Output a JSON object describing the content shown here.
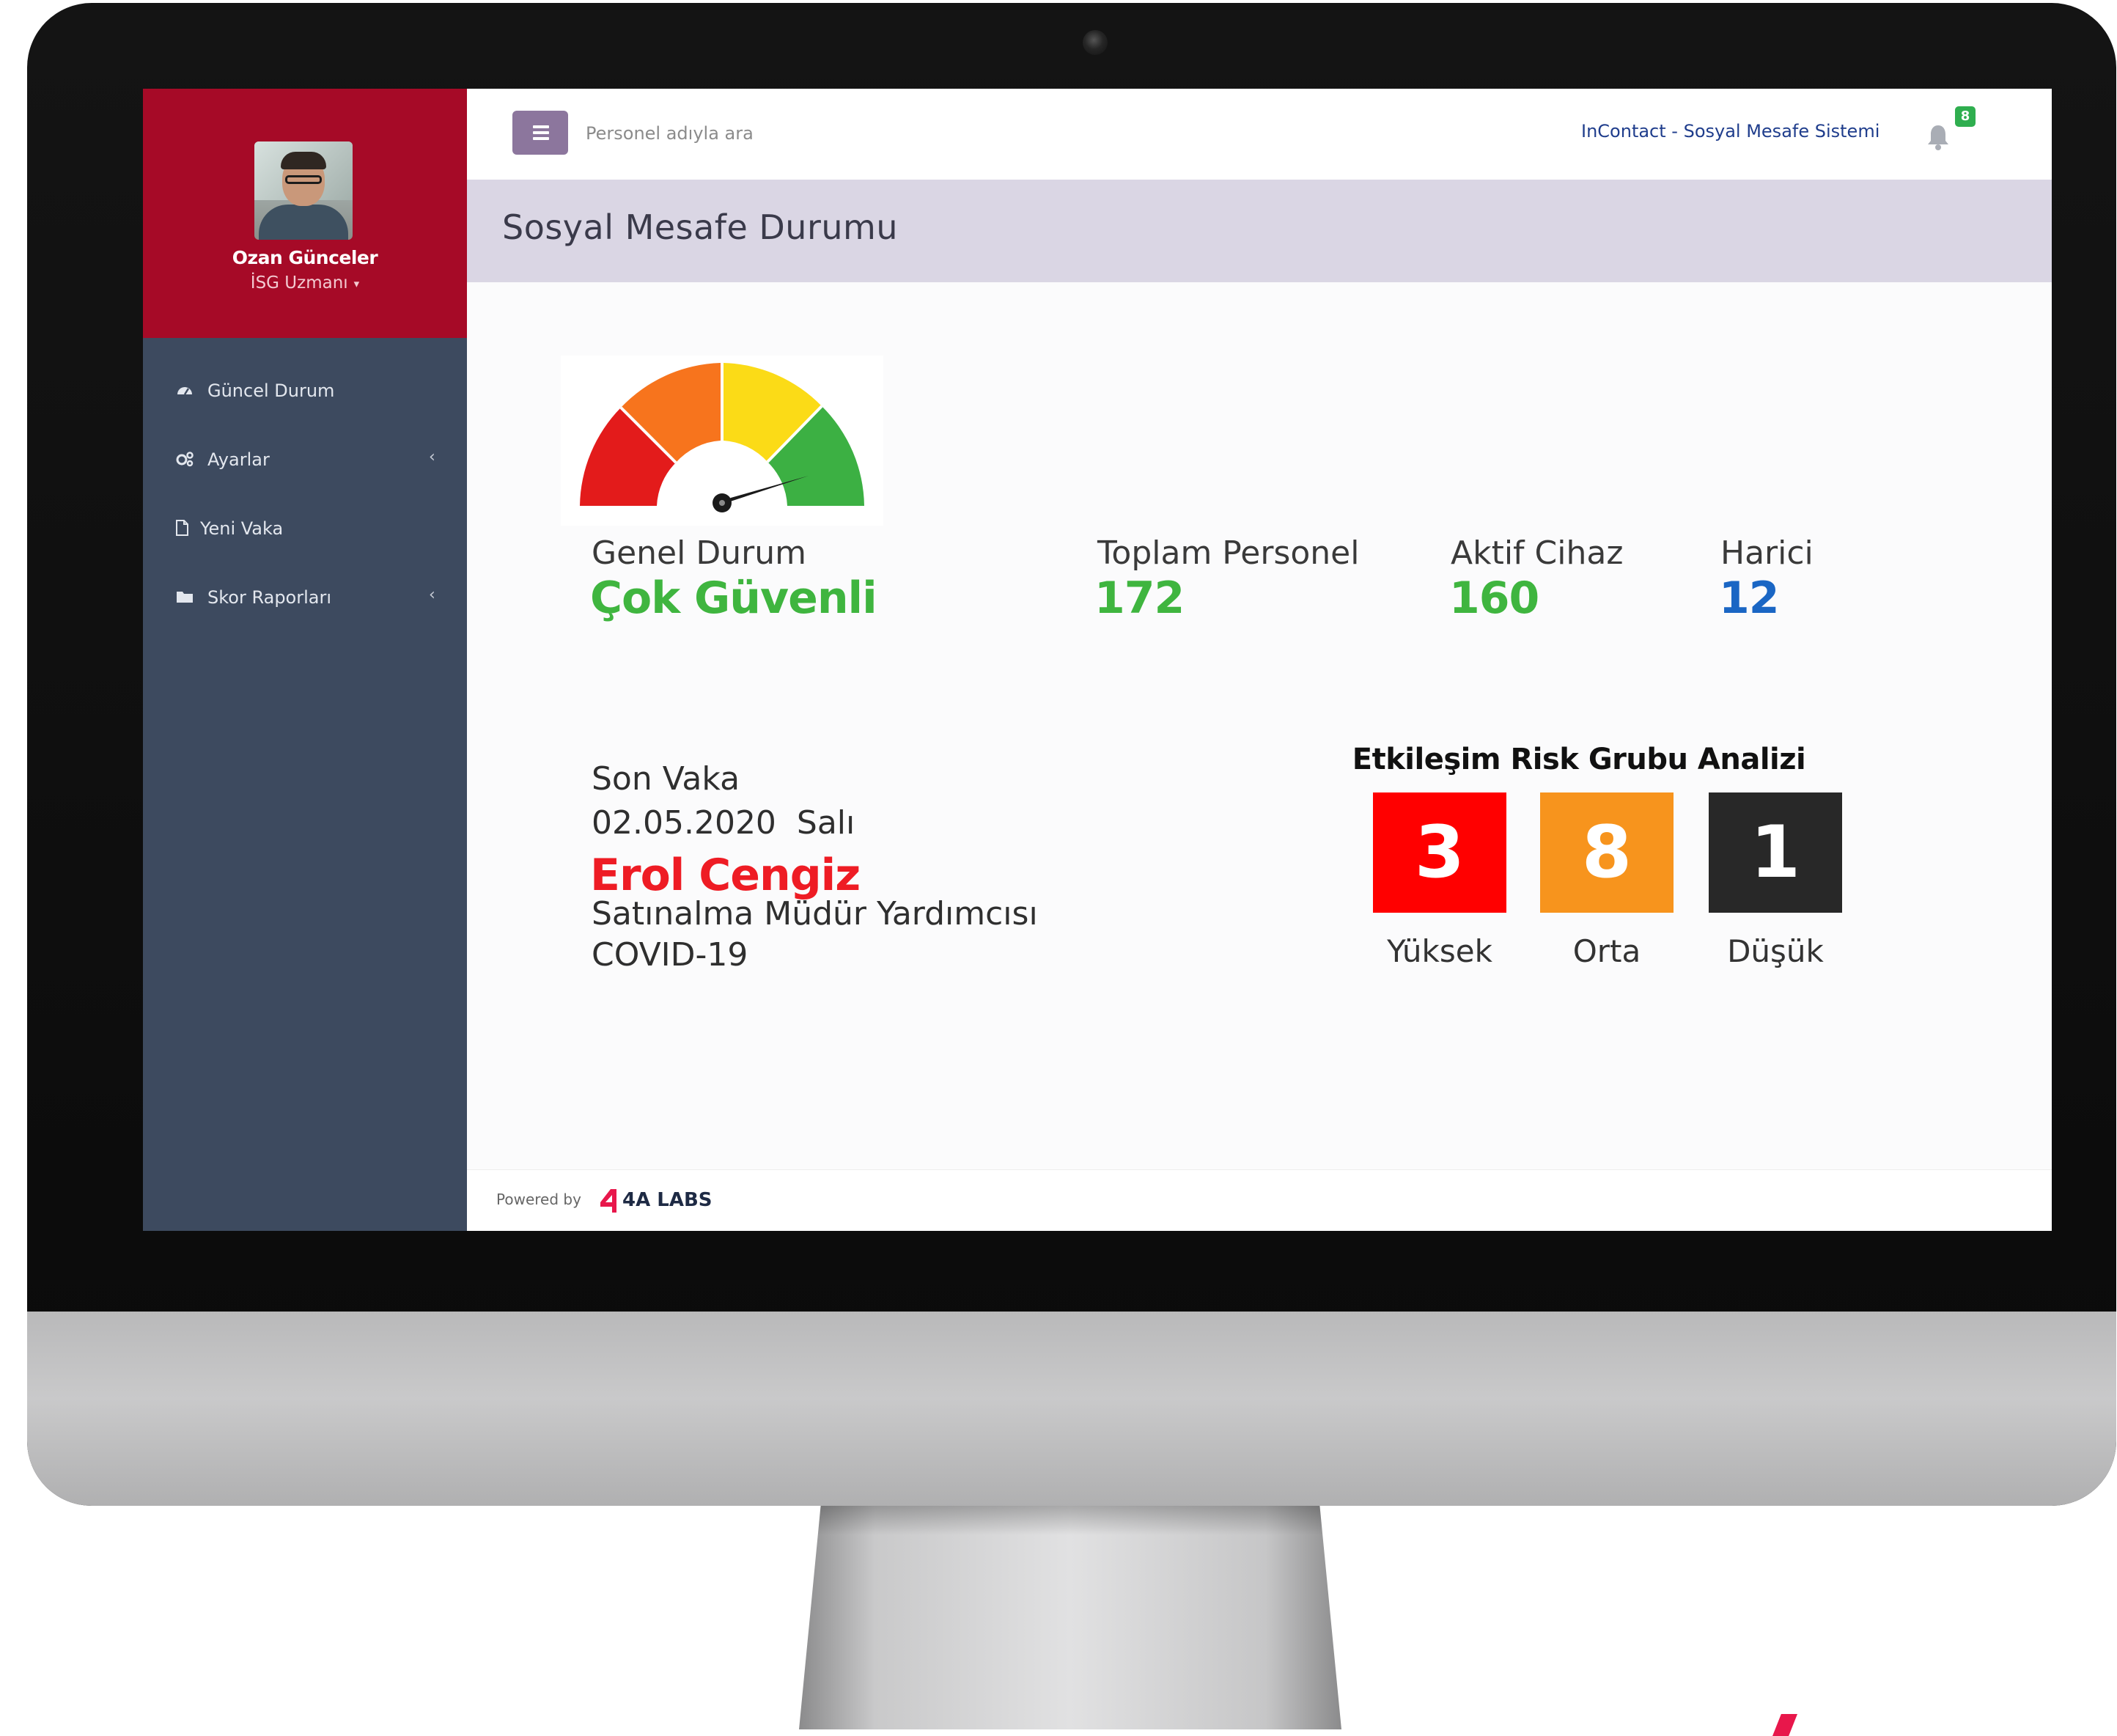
{
  "profile": {
    "name": "Ozan Günceler",
    "role": "İSG Uzmanı"
  },
  "sidebar": {
    "items": [
      {
        "label": "Güncel Durum",
        "icon": "dashboard-icon"
      },
      {
        "label": "Ayarlar",
        "icon": "cogs-icon",
        "has_submenu": true
      },
      {
        "label": "Yeni Vaka",
        "icon": "file-icon"
      },
      {
        "label": "Skor Raporları",
        "icon": "folder-icon",
        "has_submenu": true
      }
    ]
  },
  "topbar": {
    "search_placeholder": "Personel adıyla ara",
    "system_name": "InContact - Sosyal Mesafe Sistemi",
    "notification_count": "8"
  },
  "page": {
    "title": "Sosyal Mesafe Durumu"
  },
  "stats": {
    "general": {
      "label": "Genel Durum",
      "value": "Çok Güvenli"
    },
    "total": {
      "label": "Toplam Personel",
      "value": "172"
    },
    "active": {
      "label": "Aktif Cihaz",
      "value": "160"
    },
    "external": {
      "label": "Harici",
      "value": "12"
    }
  },
  "gauge": {
    "level": "Çok Güvenli",
    "segments": [
      "#e31b1b",
      "#f7741d",
      "#fbdb17",
      "#3cb043"
    ]
  },
  "last_case": {
    "label": "Son Vaka",
    "date": "02.05.2020  Salı",
    "name": "Erol Cengiz",
    "position": "Satınalma Müdür Yardımcısı",
    "diagnosis": "COVID-19"
  },
  "risk": {
    "title": "Etkileşim Risk Grubu Analizi",
    "groups": [
      {
        "value": "3",
        "label": "Yüksek",
        "color": "#ff0000"
      },
      {
        "value": "8",
        "label": "Orta",
        "color": "#f7941d"
      },
      {
        "value": "1",
        "label": "Düşük",
        "color": "#282828"
      }
    ]
  },
  "footer": {
    "powered_by": "Powered by",
    "brand": "4A LABS"
  },
  "colors": {
    "sidebar": "#3d4a5f",
    "profile": "#a60a27",
    "header_band": "#dad6e4",
    "menu_button": "#8c769d",
    "accent_green": "#3fb53f",
    "accent_blue": "#1a66c4",
    "accent_red": "#ee1c24"
  }
}
